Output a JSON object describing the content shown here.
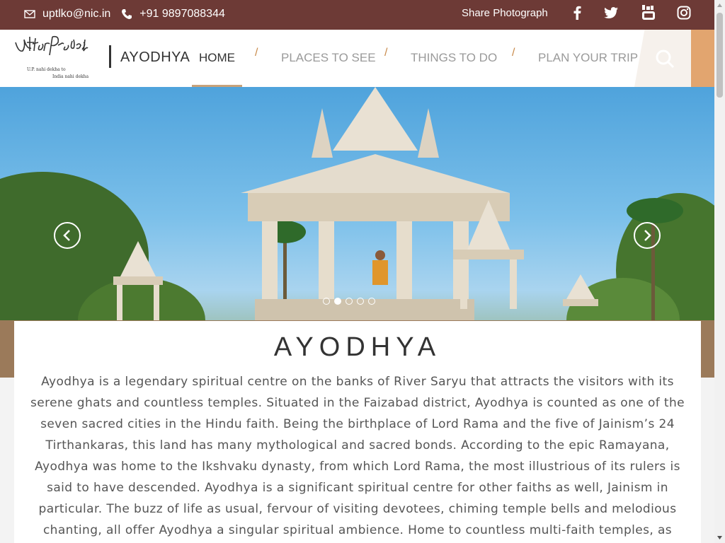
{
  "topbar": {
    "email": "uptlko@nic.in",
    "phone": "+91 9897088344",
    "share_label": "Share Photograph",
    "social": [
      "facebook-icon",
      "twitter-icon",
      "youtube-icon",
      "instagram-icon"
    ]
  },
  "header": {
    "logo_alt": "Uttar Pradesh — U.P. nahi dekha to India nahi dekha",
    "city": "AYODHYA",
    "nav": [
      {
        "label": "HOME",
        "active": true
      },
      {
        "label": "PLACES TO SEE",
        "active": false
      },
      {
        "label": "THINGS TO DO",
        "active": false
      },
      {
        "label": "PLAN YOUR TRIP",
        "active": false
      }
    ],
    "separator": "/"
  },
  "hero": {
    "slide_count": 5,
    "active_slide": 1
  },
  "content": {
    "title": "AYODHYA",
    "body": "Ayodhya is a legendary spiritual centre on the banks of River Saryu that attracts the visitors with its serene ghats and countless temples. Situated in the Faizabad district, Ayodhya is counted as one of the seven sacred cities in the Hindu faith. Being the birthplace of Lord Rama and the five of Jainism’s 24 Tirthankaras, this land has many mythological and sacred bonds. According to the epic Ramayana, Ayodhya was home to the Ikshvaku dynasty, from which Lord Rama, the most illustrious of its rulers is said to have descended. Ayodhya is a significant spiritual centre for other faiths as well, Jainism in particular. The buzz of life as usual, fervour of visiting devotees, chiming temple bells and melodious chanting, all offer Ayodhya a singular spiritual ambience. Home to countless multi-faith temples, as"
  },
  "colors": {
    "topbar": "#6d3a36",
    "accent": "#e2a56f",
    "underline": "#c8a27a"
  }
}
